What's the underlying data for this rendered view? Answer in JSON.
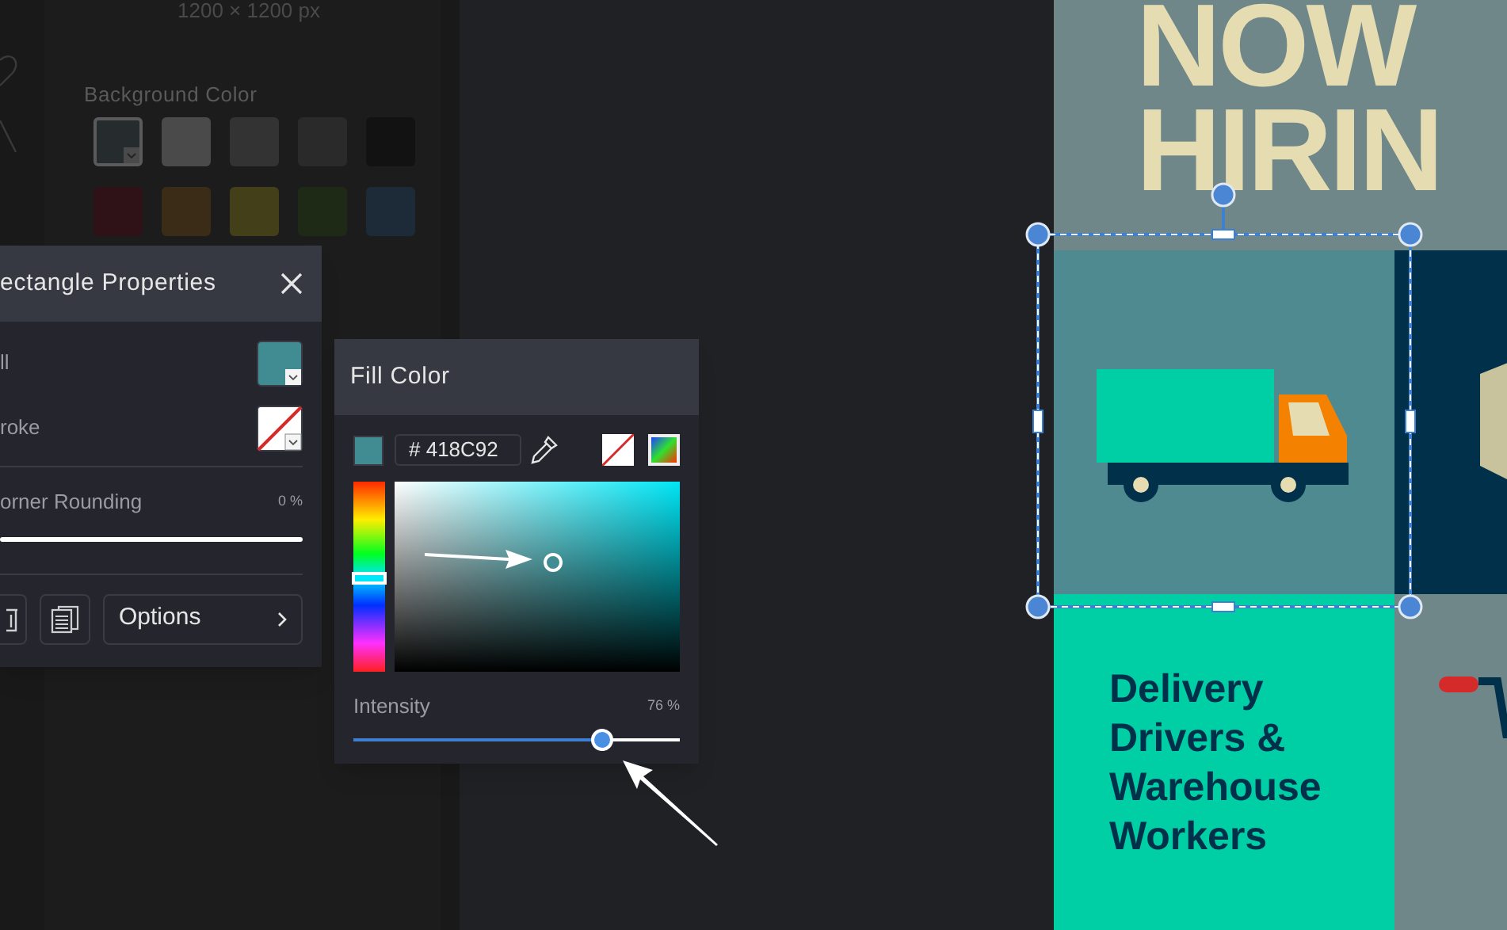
{
  "canvas_size": "1200 × 1200 px",
  "background_color": {
    "label": "Background Color",
    "swatches": [
      {
        "color": "#262b2e",
        "selected": true
      },
      {
        "color": "#4a4a4a",
        "selected": false
      },
      {
        "color": "#333333",
        "selected": false
      },
      {
        "color": "#2a2a2a",
        "selected": false
      },
      {
        "color": "#121212",
        "selected": false
      },
      {
        "color": "#2f1218",
        "selected": false
      },
      {
        "color": "#3a2c16",
        "selected": false
      },
      {
        "color": "#434019",
        "selected": false
      },
      {
        "color": "#1e2a16",
        "selected": false
      },
      {
        "color": "#1d2a38",
        "selected": false
      }
    ]
  },
  "properties_panel": {
    "title": "ectangle Properties",
    "fill_label": "ll",
    "stroke_label": "roke",
    "corner_rounding": {
      "label": "orner Rounding",
      "reading": "0 %",
      "level": 0
    },
    "options_label": "Options"
  },
  "fill_color_panel": {
    "title": "Fill Color",
    "hex": "# 418C92",
    "color": "#418c92",
    "hue": {
      "level": 0.51
    },
    "intensity": {
      "label": "Intensity",
      "reading": "76 %",
      "level": 0.76
    }
  },
  "poster": {
    "headline": [
      "NOW",
      "HIRIN"
    ],
    "caption": [
      "Delivery",
      "Drivers &",
      "Warehouse",
      "Workers"
    ]
  }
}
